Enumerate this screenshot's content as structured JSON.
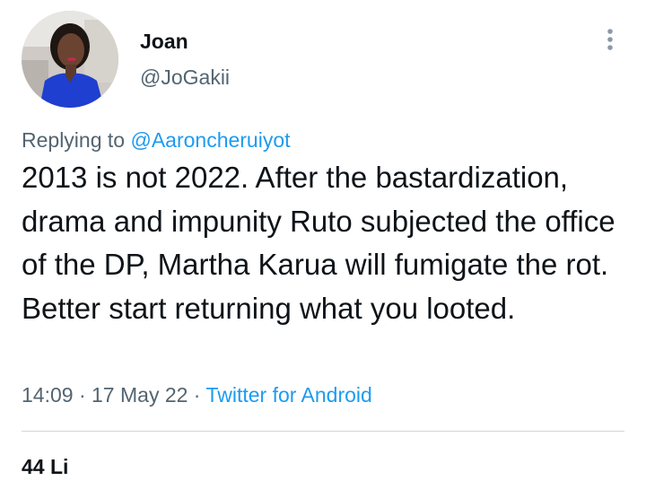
{
  "author": {
    "display_name": "Joan",
    "handle": "@JoGakii",
    "avatar_icon": "profile-photo"
  },
  "reply": {
    "prefix": "Replying to ",
    "target": "@Aaroncheruiyot"
  },
  "tweet": {
    "text": "2013 is not 2022. After the bastardization, drama and impunity Ruto subjected the office of the DP, Martha Karua will fumigate the rot. Better start returning what you looted."
  },
  "meta": {
    "time": "14:09",
    "separator_1": " · ",
    "date": "17 May 22",
    "separator_2": " · ",
    "source": "Twitter for Android"
  },
  "stats": {
    "partial_text": "44 Li"
  },
  "colors": {
    "text_primary": "#0f1419",
    "text_secondary": "#536471",
    "link": "#1d9bf0",
    "divider": "#cfd9de"
  },
  "icons": {
    "more": "more-vertical-icon"
  }
}
